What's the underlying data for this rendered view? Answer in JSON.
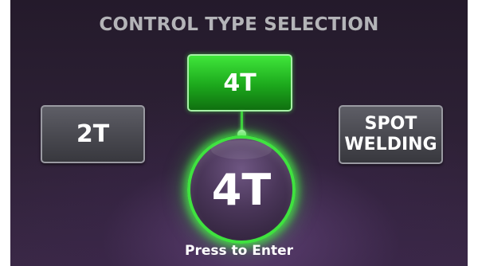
{
  "screen": {
    "title": "CONTROL TYPE SELECTION",
    "hint": "Press to Enter"
  },
  "options": {
    "left": {
      "label": "2T"
    },
    "top": {
      "label": "4T",
      "selected": true
    },
    "right": {
      "line1": "SPOT",
      "line2": "WELDING"
    }
  },
  "knob": {
    "value": "4T"
  },
  "colors": {
    "selected_green": "#2ed12e",
    "button_gray": "#4c4c54",
    "background": "#2c2034",
    "title_gray": "#b4b4b8"
  }
}
